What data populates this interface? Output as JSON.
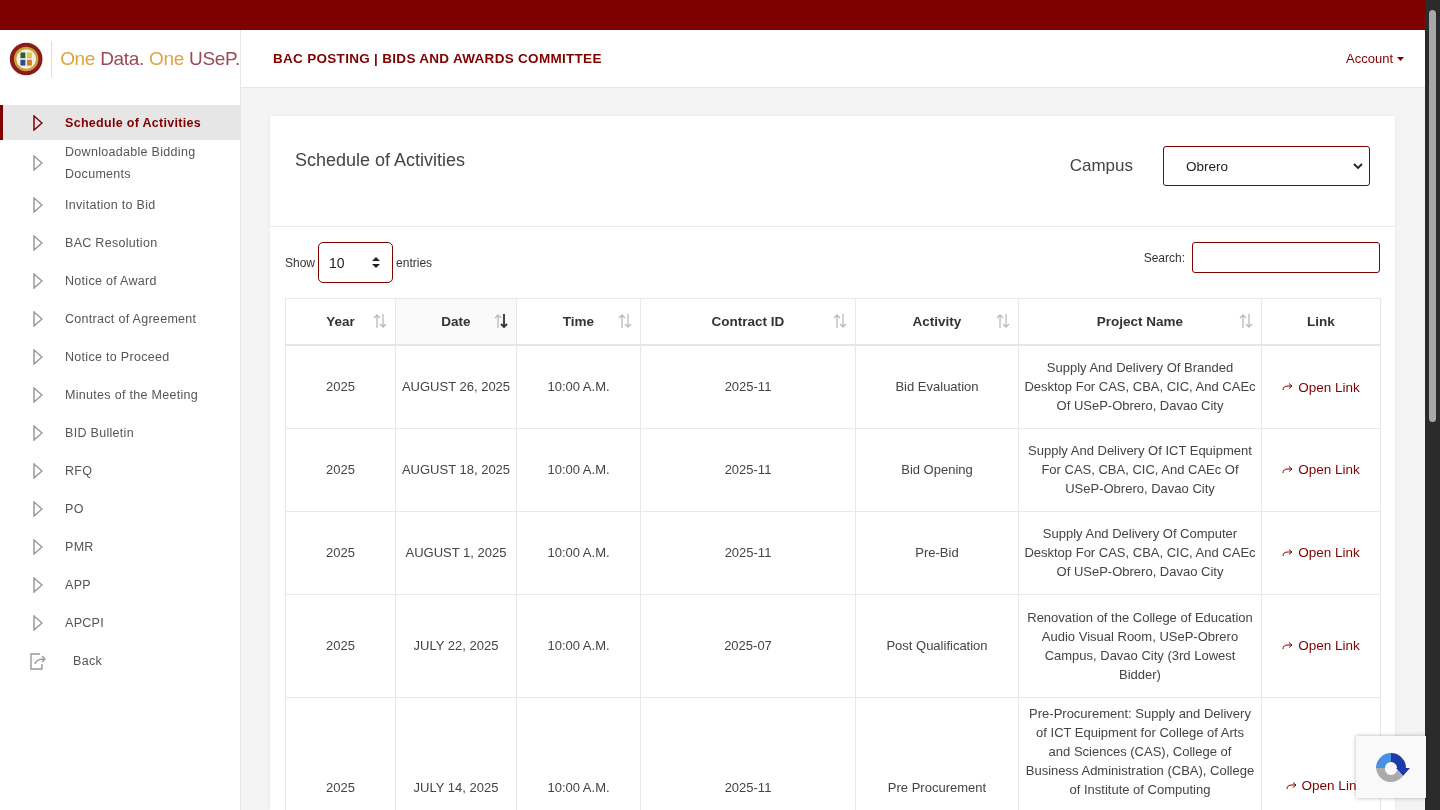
{
  "brand": {
    "parts": [
      {
        "text": "One",
        "color": "#e0a33c"
      },
      {
        "text": "Data.",
        "color": "#9b4a55"
      },
      {
        "text": "One",
        "color": "#e0a33c"
      },
      {
        "text": "USeP.",
        "color": "#9b4a55"
      }
    ]
  },
  "header": {
    "title": "BAC POSTING | BIDS AND AWARDS COMMITTEE",
    "account": "Account"
  },
  "sidebar": {
    "items": [
      {
        "label": "Schedule of Activities",
        "kind": "nav",
        "selected": true
      },
      {
        "label": "Downloadable Bidding Documents",
        "kind": "nav",
        "selected": false
      },
      {
        "label": "Invitation to Bid",
        "kind": "nav",
        "selected": false
      },
      {
        "label": "BAC Resolution",
        "kind": "nav",
        "selected": false
      },
      {
        "label": "Notice of Award",
        "kind": "nav",
        "selected": false
      },
      {
        "label": "Contract of Agreement",
        "kind": "nav",
        "selected": false
      },
      {
        "label": "Notice to Proceed",
        "kind": "nav",
        "selected": false
      },
      {
        "label": "Minutes of the Meeting",
        "kind": "nav",
        "selected": false
      },
      {
        "label": "BID Bulletin",
        "kind": "nav",
        "selected": false
      },
      {
        "label": "RFQ",
        "kind": "nav",
        "selected": false
      },
      {
        "label": "PO",
        "kind": "nav",
        "selected": false
      },
      {
        "label": "PMR",
        "kind": "nav",
        "selected": false
      },
      {
        "label": "APP",
        "kind": "nav",
        "selected": false
      },
      {
        "label": "APCPI",
        "kind": "nav",
        "selected": false
      },
      {
        "label": "Back",
        "kind": "exit",
        "selected": false
      }
    ]
  },
  "card": {
    "title": "Schedule of Activities",
    "campus_label": "Campus",
    "campus_value": "Obrero"
  },
  "table_controls": {
    "show_label": "Show",
    "entries_value": "10",
    "entries_label": "entries",
    "search_label": "Search:"
  },
  "table": {
    "columns": [
      {
        "label": "Year",
        "sortable": true,
        "sorted": false
      },
      {
        "label": "Date",
        "sortable": true,
        "sorted": true
      },
      {
        "label": "Time",
        "sortable": true,
        "sorted": false
      },
      {
        "label": "Contract ID",
        "sortable": true,
        "sorted": false
      },
      {
        "label": "Activity",
        "sortable": true,
        "sorted": false
      },
      {
        "label": "Project Name",
        "sortable": true,
        "sorted": false
      },
      {
        "label": "Link",
        "sortable": false
      }
    ],
    "rows": [
      {
        "year": "2025",
        "date": "AUGUST 26, 2025",
        "time": "10:00 A.M.",
        "contract_id": "2025-11",
        "activity": "Bid Evaluation",
        "project": "Supply And Delivery Of Branded Desktop For CAS, CBA, CIC, And CAEc Of USeP-Obrero, Davao City",
        "link": "Open Link"
      },
      {
        "year": "2025",
        "date": "AUGUST 18, 2025",
        "time": "10:00 A.M.",
        "contract_id": "2025-11",
        "activity": "Bid Opening",
        "project": "Supply And Delivery Of ICT Equipment For CAS, CBA, CIC, And CAEc Of USeP-Obrero, Davao City",
        "link": "Open Link"
      },
      {
        "year": "2025",
        "date": "AUGUST 1, 2025",
        "time": "10:00 A.M.",
        "contract_id": "2025-11",
        "activity": "Pre-Bid",
        "project": "Supply And Delivery Of Computer Desktop For CAS, CBA, CIC, And CAEc Of USeP-Obrero, Davao City",
        "link": "Open Link"
      },
      {
        "year": "2025",
        "date": "JULY 22, 2025",
        "time": "10:00 A.M.",
        "contract_id": "2025-07",
        "activity": "Post Qualification",
        "project": "Renovation of the College of Education Audio Visual Room, USeP-Obrero Campus, Davao City (3rd Lowest Bidder)",
        "link": "Open Link"
      },
      {
        "year": "2025",
        "date": "JULY 14, 2025",
        "time": "10:00 A.M.",
        "contract_id": "2025-11",
        "activity": "Pre Procurement",
        "project": "Pre-Procurement: Supply and Delivery of ICT Equipment for College of Arts and Sciences (CAS), College of Business Administration (CBA), College of Institute of Computing",
        "link": "Open Lin"
      }
    ]
  }
}
